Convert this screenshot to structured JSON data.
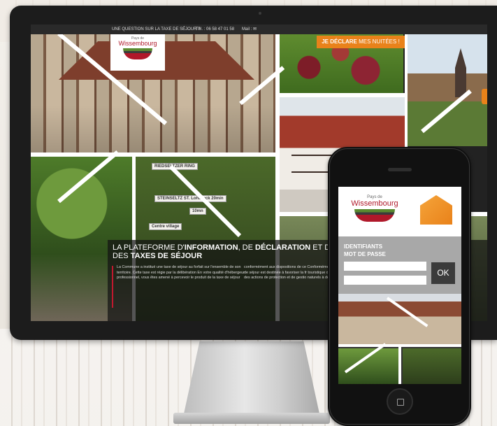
{
  "site": {
    "topbar": {
      "question": "UNE QUESTION SUR LA TAXE DE SÉJOUR ?",
      "tel_label": "Tél. : 06 58 47 01 58",
      "mail_label": "Mail :"
    },
    "logo": {
      "small": "Pays de",
      "main": "Wissembourg"
    },
    "banner": {
      "strong": "JE DÉCLARE",
      "rest": " MES NUITÉES !"
    },
    "signs": [
      "RIEDSELTZER RING",
      "STEINSELTZ ST. Lohbruck 20min",
      "10mn",
      "Centre village"
    ],
    "overlay": {
      "title_1": "LA PLATEFORME D'",
      "title_b1": "INFORMATION",
      "title_2": ", DE ",
      "title_b2": "DÉCLARATION",
      "title_3": " ET DE PA",
      "title_4": "DES ",
      "title_b3": "TAXES DE SÉJOUR",
      "col1": "La Commune a institué une taxe de séjour au forfait sur l'ensemble de son territoire. Cette taxe est régie par la délibération En votre qualité d'hébergeur professionnel, vous êtes amené à percevoir le produit de la taxe de séjour",
      "col2": "conformément aux dispositions de ce Conformément à la réglementation, la de séjour est destinée à favoriser la fr touristique de la collectivité ou aux dé des actions de protection et de gestio naturels à des fins touristiques."
    }
  },
  "mobile": {
    "logo": {
      "small": "Pays de",
      "main": "Wissembourg"
    },
    "label_identifiants": "IDENTIFIANTS",
    "label_password": "MOT DE PASSE",
    "ok_label": "OK"
  }
}
